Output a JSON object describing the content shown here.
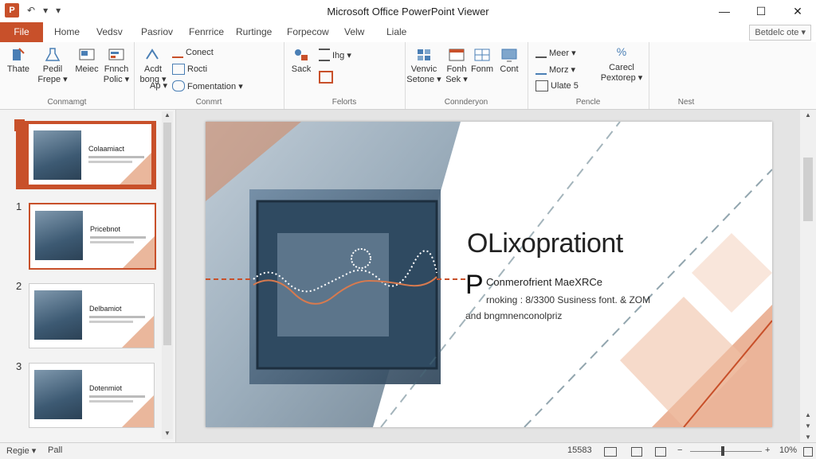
{
  "window": {
    "title": "Microsoft Office PowerPoint Viewer",
    "minimize": "—",
    "maximize": "☐",
    "close": "✕"
  },
  "qat": {
    "undo": "↶",
    "save": "▾",
    "more": "▾"
  },
  "tabs": [
    {
      "label": "File"
    },
    {
      "label": "Home"
    },
    {
      "label": "Vedsv"
    },
    {
      "label": "Pasriov"
    },
    {
      "label": "Fenrrice"
    },
    {
      "label": "Rurtinge"
    },
    {
      "label": "Forpecow"
    },
    {
      "label": "Velw"
    },
    {
      "label": "Liale"
    }
  ],
  "tabs_right": {
    "label": "Betdelc ote ▾"
  },
  "ribbon": {
    "groups": [
      {
        "label": "Conmamgt"
      },
      {
        "label": "Conmrt"
      },
      {
        "label": "Felorts"
      },
      {
        "label": "Connderyon"
      },
      {
        "label": "Pencle"
      },
      {
        "label": "Nest"
      }
    ],
    "buttons": {
      "thate": "Thate",
      "pedil": "Pedil Frepe ▾",
      "meiec": "Meiec",
      "fnnch": "Fnnch Polic ▾",
      "acdt": "Acdt bong ▾",
      "conect": "Conect",
      "rocti": "Rocti",
      "fomentation": "Fomentation ▾",
      "ap": "Ap ▾",
      "sack": "Sack",
      "ihg": "Ihg ▾",
      "venoc": "Venvic Setone ▾",
      "fonh": "Fonh Sek ▾",
      "fonm": "Fonm",
      "cont": "Cont",
      "meer": "Meer ▾",
      "morz": "Morz ▾",
      "ulate": "Ulate 5",
      "percent": "%",
      "caresl": "Carecl Pextorep ▾"
    }
  },
  "thumbnails": [
    {
      "num": "1",
      "title": "Colaamiact",
      "selected": true
    },
    {
      "num": "1",
      "title": "Pricebnot",
      "selected": false
    },
    {
      "num": "2",
      "title": "Delbamiot",
      "selected": false
    },
    {
      "num": "3",
      "title": "Dotenmiot",
      "selected": false
    }
  ],
  "slide": {
    "title": "OLixoprationt",
    "big_letter": "P",
    "line1": "Conmerofrient MaeXRCe",
    "line2": "rnoking : 8/3300 Susiness font. & ZOM",
    "line3": "and bngmnenconolpriz"
  },
  "status": {
    "left": "Regie ▾",
    "left2": "Pall",
    "count": "15583",
    "zoom": "10%"
  },
  "colors": {
    "accent": "#c8502a",
    "slide_orange": "#e8a07c"
  }
}
